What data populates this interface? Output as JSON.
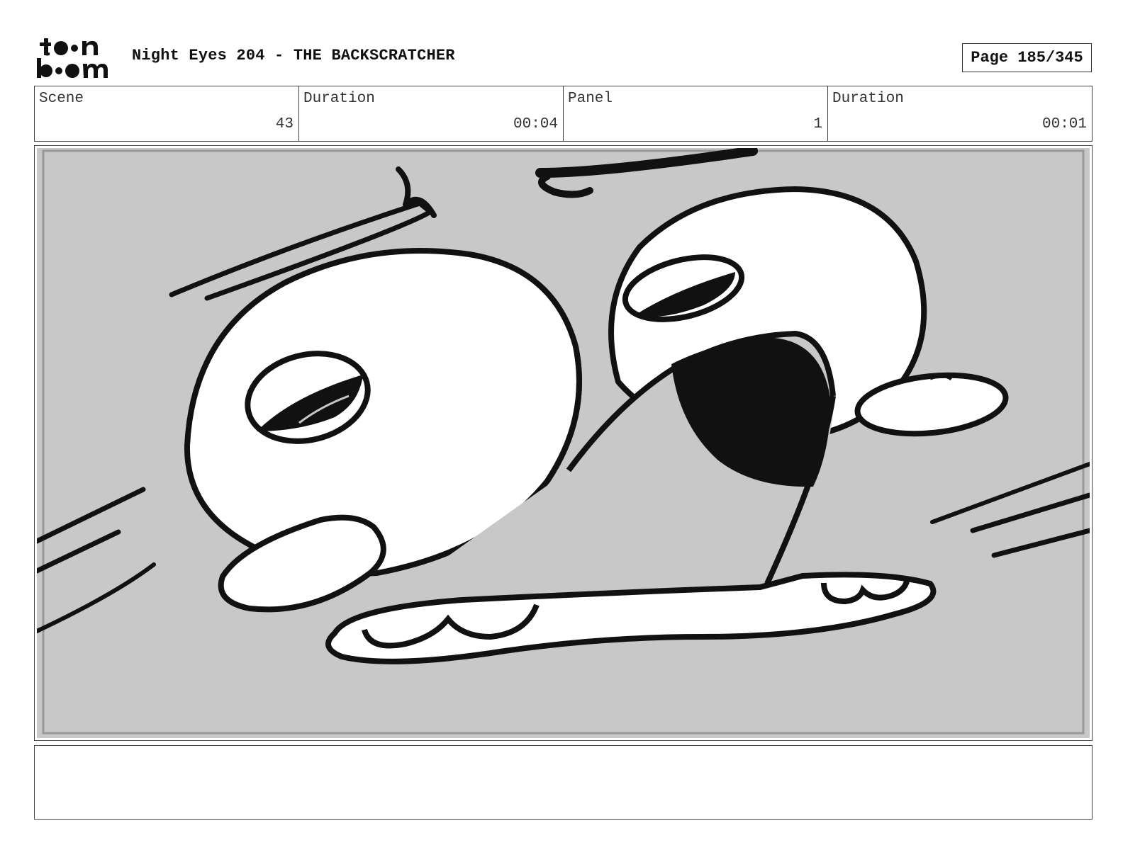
{
  "header": {
    "logo_text_top": "toon",
    "logo_text_bottom": "boom",
    "title": "Night Eyes 204 - THE BACKSCRATCHER",
    "page_label": "Page",
    "page_value": "185/345"
  },
  "info": {
    "scene_label": "Scene",
    "scene_value": "43",
    "scene_duration_label": "Duration",
    "scene_duration_value": "00:04",
    "panel_label": "Panel",
    "panel_value": "1",
    "panel_duration_label": "Duration",
    "panel_duration_value": "00:01"
  },
  "panel": {
    "background_color": "#c8c8c8",
    "line_color": "#111111",
    "fill_color": "#ffffff"
  },
  "notes": {
    "text": ""
  }
}
